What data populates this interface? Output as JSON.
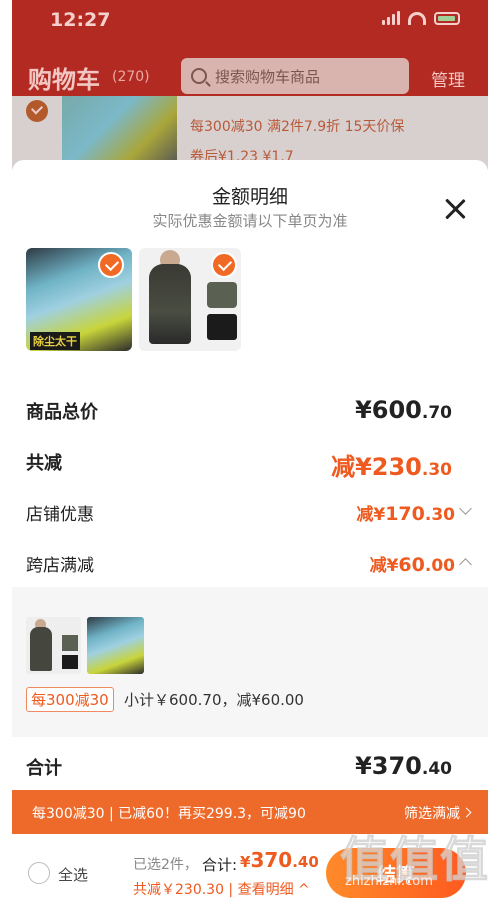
{
  "status_bar": {
    "time": "12:27"
  },
  "cart_header": {
    "title": "购物车",
    "count": "(270)",
    "search_placeholder": "搜索购物车商品",
    "manage": "管理"
  },
  "bg_item": {
    "promo_text": "每300减30   满2件7.9折   15天价保",
    "price_text": "券后¥1.23 ¥1.7"
  },
  "sheet": {
    "title": "金额明细",
    "subtitle": "实际优惠金额请以下单页为准",
    "images": [
      {
        "name": "除尘软胶",
        "tag": "除尘太干"
      },
      {
        "name": "男士棉服"
      }
    ],
    "rows": {
      "total_price": {
        "label": "商品总价",
        "symbol": "¥",
        "int": "600",
        "cents": ".70"
      },
      "total_discount": {
        "label": "共减",
        "prefix": "减",
        "symbol": "¥",
        "int": "230",
        "cents": ".30"
      },
      "shop_discount": {
        "label": "店铺优惠",
        "prefix": "减",
        "symbol": "¥",
        "int": "170",
        "cents": ".30"
      },
      "cross_shop": {
        "label": "跨店满减",
        "prefix": "减",
        "symbol": "¥",
        "int": "60",
        "cents": ".00"
      },
      "grand_total": {
        "label": "合计",
        "symbol": "¥",
        "int": "370",
        "cents": ".40"
      }
    },
    "cross_shop_detail": {
      "tag": "每300减30",
      "subtotal": "小计￥600.70，减¥60.00"
    }
  },
  "promo_bar": {
    "text": "每300减30 | 已减60！再买299.3，可减90",
    "link": "筛选满减"
  },
  "bottom_bar": {
    "select_all": "全选",
    "selected_count": "已选2件，",
    "total_label": "合计:",
    "total_symbol": "¥",
    "total_int": "370",
    "total_cents": ".40",
    "discount_line": "共减￥230.30 | 查看明细 ^",
    "checkout": "结算"
  },
  "watermark": {
    "text": "值值值",
    "url": "zhizhizhi.com"
  },
  "colors": {
    "accent": "#ee5a1f",
    "header_red": "#b22a22",
    "promo_bar": "#ee6a2a"
  }
}
